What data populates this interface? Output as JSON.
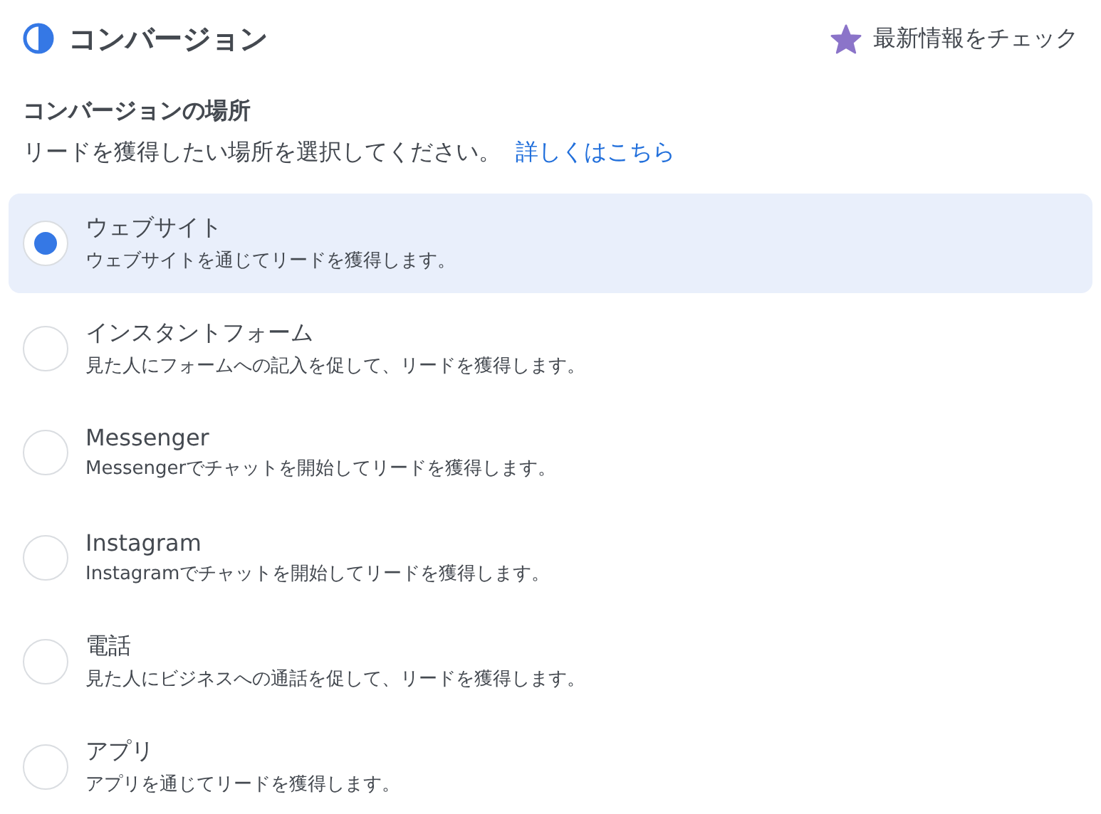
{
  "header": {
    "title": "コンバージョン",
    "news_link": "最新情報をチェック"
  },
  "section": {
    "title": "コンバージョンの場所",
    "description": "リードを獲得したい場所を選択してください。",
    "learn_more": "詳しくはこちら"
  },
  "options": [
    {
      "label": "ウェブサイト",
      "description": "ウェブサイトを通じてリードを獲得します。",
      "selected": true
    },
    {
      "label": "インスタントフォーム",
      "description": "見た人にフォームへの記入を促して、リードを獲得します。",
      "selected": false
    },
    {
      "label": "Messenger",
      "description": "Messengerでチャットを開始してリードを獲得します。",
      "selected": false
    },
    {
      "label": "Instagram",
      "description": "Instagramでチャットを開始してリードを獲得します。",
      "selected": false
    },
    {
      "label": "電話",
      "description": "見た人にビジネスへの通話を促して、リードを獲得します。",
      "selected": false
    },
    {
      "label": "アプリ",
      "description": "アプリを通じてリードを獲得します。",
      "selected": false
    }
  ]
}
